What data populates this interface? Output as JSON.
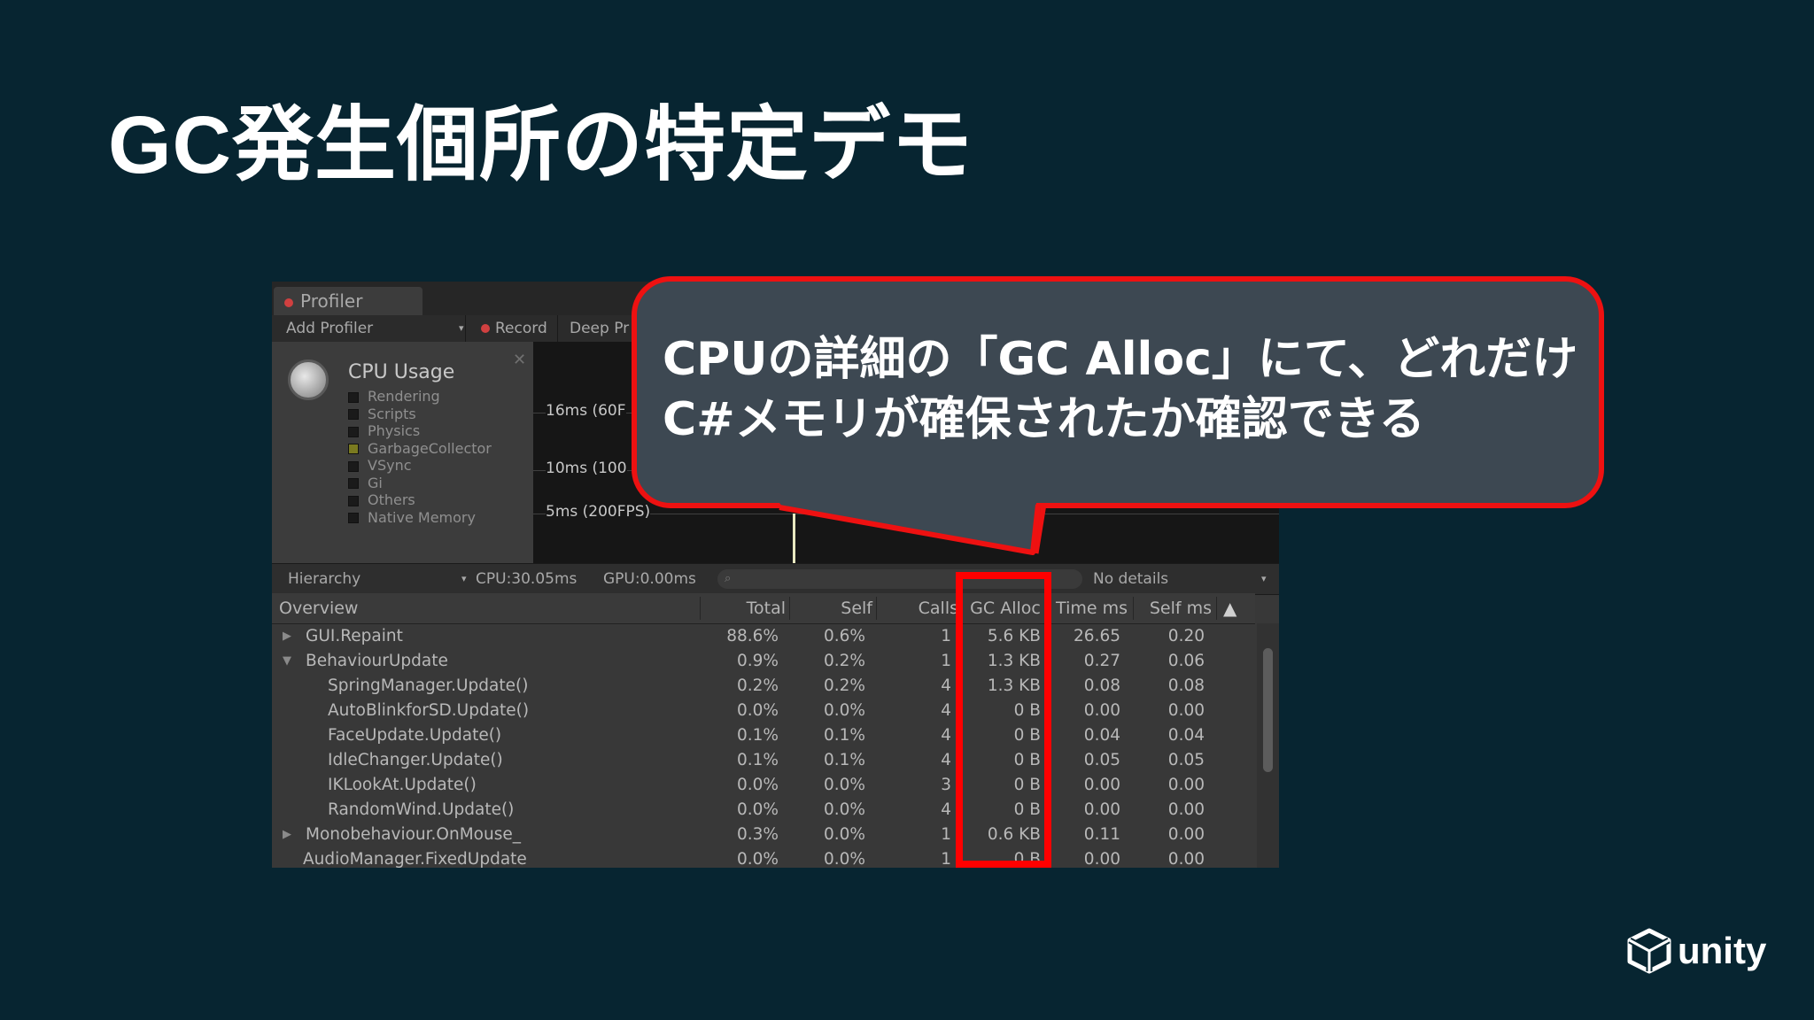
{
  "slide": {
    "title": "GC発生個所の特定デモ",
    "callout_line1": "CPUの詳細の「GC Alloc」にて、どれだけ",
    "callout_line2": "C#メモリが確保されたか確認できる",
    "logo_text": "unity"
  },
  "profiler": {
    "tab_label": "Profiler",
    "toolbar": {
      "add_profiler": "Add Profiler",
      "record": "Record",
      "deep_profile": "Deep Pr"
    },
    "cpu_panel": {
      "title": "CPU Usage",
      "legend": [
        {
          "label": "Rendering",
          "color": "#1a1a1a"
        },
        {
          "label": "Scripts",
          "color": "#1a1a1a"
        },
        {
          "label": "Physics",
          "color": "#1a1a1a"
        },
        {
          "label": "GarbageCollector",
          "color": "#7a7a20"
        },
        {
          "label": "VSync",
          "color": "#1a1a1a"
        },
        {
          "label": "Gi",
          "color": "#1a1a1a"
        },
        {
          "label": "Others",
          "color": "#1a1a1a"
        },
        {
          "label": "Native Memory",
          "color": "#1a1a1a"
        }
      ]
    },
    "graph": {
      "label_16ms": "16ms (60F",
      "label_10ms": "10ms (100",
      "label_5ms": "5ms (200FPS)"
    },
    "hierarchy_bar": {
      "view": "Hierarchy",
      "cpu": "CPU:30.05ms",
      "gpu": "GPU:0.00ms",
      "details": "No details"
    },
    "columns": [
      "Overview",
      "Total",
      "Self",
      "Calls",
      "GC Alloc",
      "Time ms",
      "Self ms"
    ],
    "rows": [
      {
        "name": "GUI.Repaint",
        "expander": "▶",
        "total": "88.6%",
        "self": "0.6%",
        "calls": "1",
        "gc": "5.6 KB",
        "time": "26.65",
        "self_ms": "0.20"
      },
      {
        "name": "BehaviourUpdate",
        "expander": "▼",
        "total": "0.9%",
        "self": "0.2%",
        "calls": "1",
        "gc": "1.3 KB",
        "time": "0.27",
        "self_ms": "0.06"
      },
      {
        "name": "SpringManager.Update()",
        "expander": "",
        "total": "0.2%",
        "self": "0.2%",
        "calls": "4",
        "gc": "1.3 KB",
        "time": "0.08",
        "self_ms": "0.08"
      },
      {
        "name": "AutoBlinkforSD.Update()",
        "expander": "",
        "total": "0.0%",
        "self": "0.0%",
        "calls": "4",
        "gc": "0 B",
        "time": "0.00",
        "self_ms": "0.00"
      },
      {
        "name": "FaceUpdate.Update()",
        "expander": "",
        "total": "0.1%",
        "self": "0.1%",
        "calls": "4",
        "gc": "0 B",
        "time": "0.04",
        "self_ms": "0.04"
      },
      {
        "name": "IdleChanger.Update()",
        "expander": "",
        "total": "0.1%",
        "self": "0.1%",
        "calls": "4",
        "gc": "0 B",
        "time": "0.05",
        "self_ms": "0.05"
      },
      {
        "name": "IKLookAt.Update()",
        "expander": "",
        "total": "0.0%",
        "self": "0.0%",
        "calls": "3",
        "gc": "0 B",
        "time": "0.00",
        "self_ms": "0.00"
      },
      {
        "name": "RandomWind.Update()",
        "expander": "",
        "total": "0.0%",
        "self": "0.0%",
        "calls": "4",
        "gc": "0 B",
        "time": "0.00",
        "self_ms": "0.00"
      },
      {
        "name": "Monobehaviour.OnMouse_",
        "expander": "▶",
        "total": "0.3%",
        "self": "0.0%",
        "calls": "1",
        "gc": "0.6 KB",
        "time": "0.11",
        "self_ms": "0.00"
      },
      {
        "name": "AudioManager.FixedUpdate",
        "expander": "",
        "total": "0.0%",
        "self": "0.0%",
        "calls": "1",
        "gc": "0 B",
        "time": "0.00",
        "self_ms": "0.00"
      }
    ]
  },
  "colors": {
    "background": "#072531",
    "highlight": "#ff0000",
    "callout_fill": "#3d4852"
  },
  "icons": {
    "sort": "triangle-up-icon",
    "cpu": "cpu-gauge-icon",
    "logo": "unity-cube-icon"
  }
}
